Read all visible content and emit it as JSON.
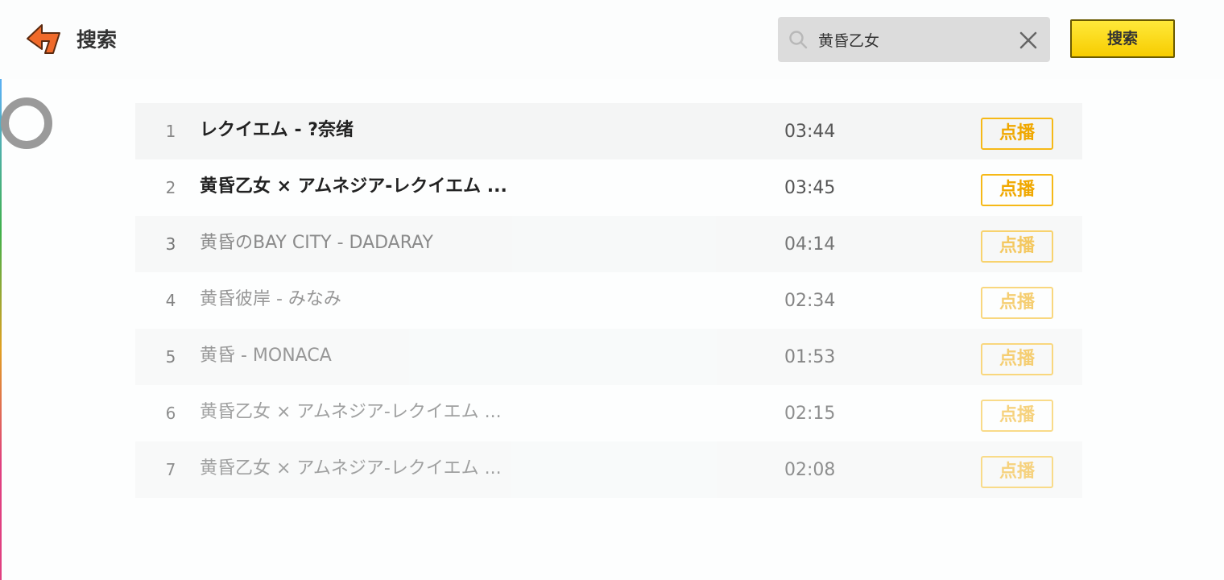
{
  "header": {
    "title": "搜索",
    "back_icon": "back-arrow-icon",
    "accent_color": "#f06a2a"
  },
  "search": {
    "value": "黄昏乙女",
    "search_icon": "search-icon",
    "clear_icon": "close-icon",
    "button_label": "搜索",
    "button_color": "#f7d400"
  },
  "loading": {
    "icon": "loading-ring-icon"
  },
  "results": [
    {
      "index": "1",
      "title": "レクイエム - ?奈绪",
      "duration": "03:44",
      "action": "点播"
    },
    {
      "index": "2",
      "title": "黄昏乙女 × アムネジア-レクイエム ...",
      "duration": "03:45",
      "action": "点播"
    },
    {
      "index": "3",
      "title": "黄昏のBAY CITY - DADARAY",
      "duration": "04:14",
      "action": "点播"
    },
    {
      "index": "4",
      "title": "黄昏彼岸 - みなみ",
      "duration": "02:34",
      "action": "点播"
    },
    {
      "index": "5",
      "title": "黄昏 - MONACA",
      "duration": "01:53",
      "action": "点播"
    },
    {
      "index": "6",
      "title": "黄昏乙女 × アムネジア-レクイエム ...",
      "duration": "02:15",
      "action": "点播"
    },
    {
      "index": "7",
      "title": "黄昏乙女 × アムネジア-レクイエム ...",
      "duration": "02:08",
      "action": "点播"
    }
  ],
  "colors": {
    "play_button_border": "#f6b917",
    "play_button_text": "#f0a800",
    "row_alt_bg": "#f4f5f5"
  }
}
